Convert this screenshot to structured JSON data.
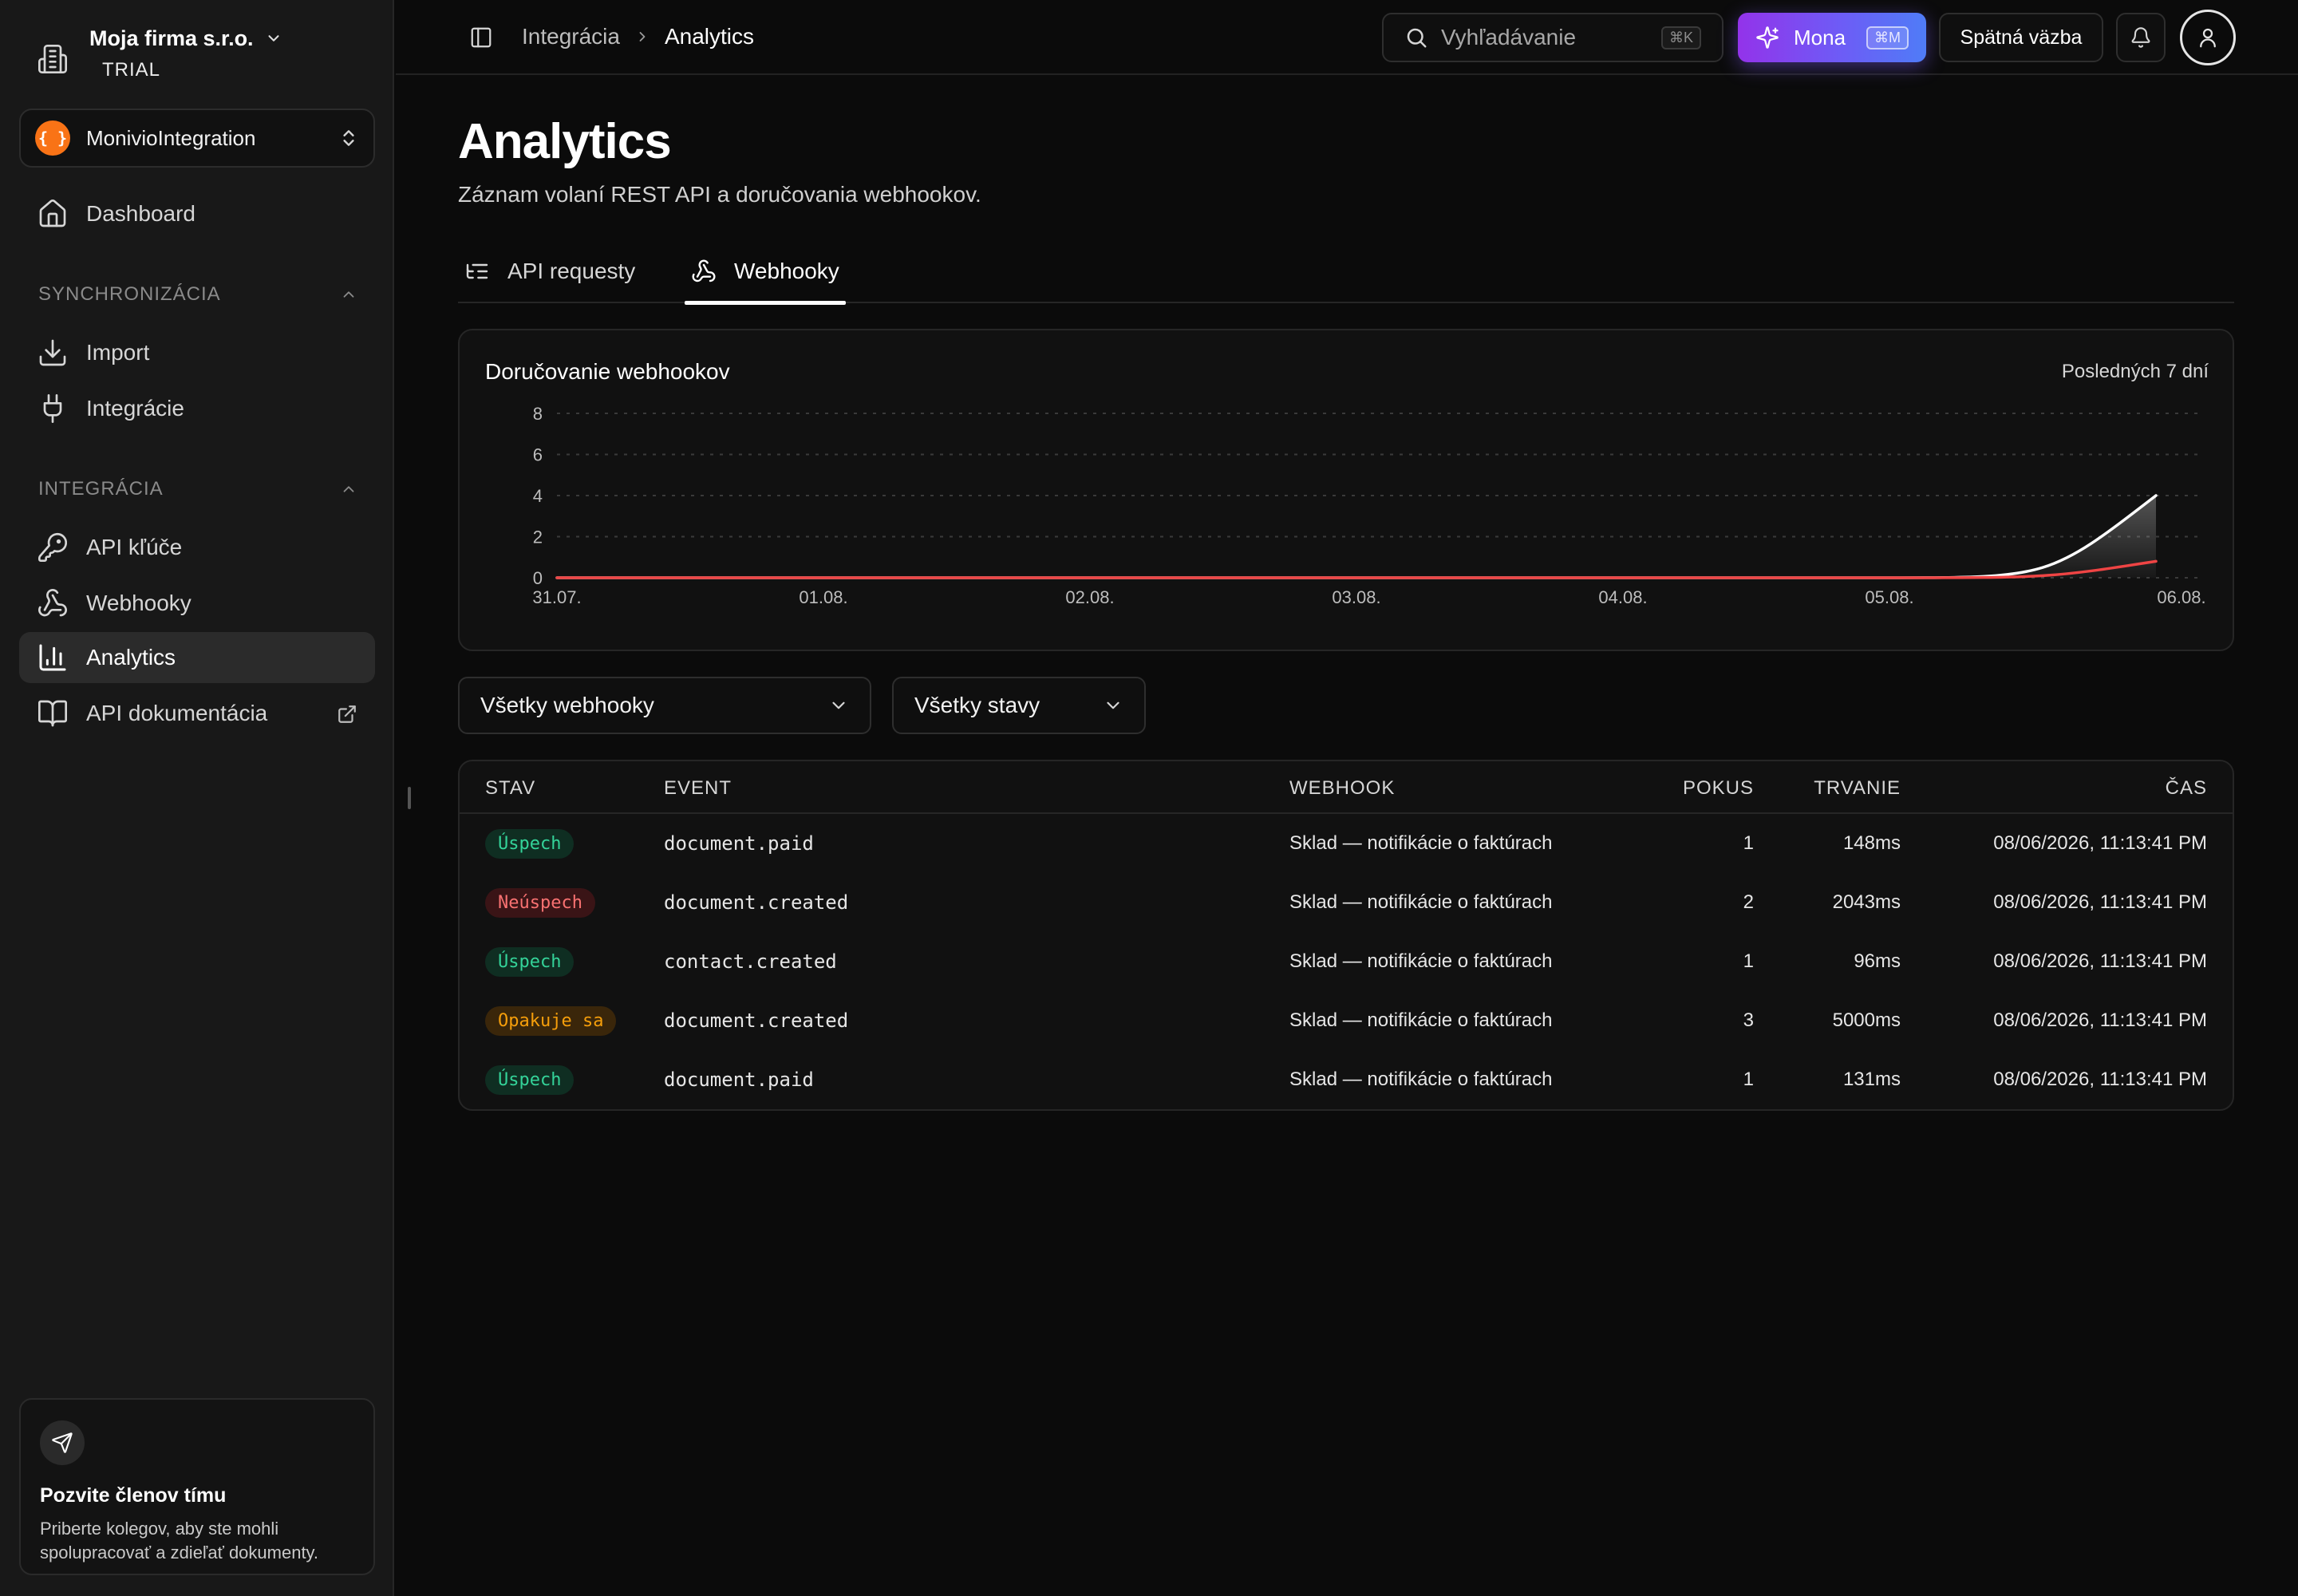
{
  "company": {
    "name": "Moja firma s.r.o.",
    "plan": "TRIAL"
  },
  "org": {
    "logo_text": "{ }",
    "name": "MonivioIntegration"
  },
  "sidebar": {
    "dashboard": "Dashboard",
    "section_sync": "SYNCHRONIZÁCIA",
    "import": "Import",
    "integracie": "Integrácie",
    "section_integration": "INTEGRÁCIA",
    "api_keys": "API kľúče",
    "webhooks": "Webhooky",
    "analytics": "Analytics",
    "api_docs": "API dokumentácia"
  },
  "invite": {
    "title": "Pozvite členov tímu",
    "desc": "Priberte kolegov, aby ste mohli spolupracovať a zdieľať dokumenty."
  },
  "breadcrumb": {
    "parent": "Integrácia",
    "current": "Analytics"
  },
  "search": {
    "placeholder": "Vyhľadávanie",
    "shortcut": "⌘K"
  },
  "mona": {
    "label": "Mona",
    "shortcut": "⌘M"
  },
  "feedback_label": "Spätná väzba",
  "page": {
    "title": "Analytics",
    "subtitle": "Záznam volaní REST API a doručovania webhookov."
  },
  "tabs": {
    "api": "API requesty",
    "webhooks": "Webhooky"
  },
  "chart_card": {
    "title": "Doručovanie webhookov",
    "range": "Posledných 7 dní"
  },
  "chart_data": {
    "type": "area",
    "title": "Doručovanie webhookov",
    "x": [
      "31.07.",
      "01.08.",
      "02.08.",
      "03.08.",
      "04.08.",
      "05.08.",
      "06.08."
    ],
    "y_ticks": [
      0,
      2,
      4,
      6,
      8
    ],
    "ylim": [
      0,
      8
    ],
    "grid": true,
    "x_end_label": "06.08.",
    "series": [
      {
        "color": "#ffffff",
        "values": [
          0,
          0,
          0,
          0,
          0,
          0,
          4
        ]
      },
      {
        "color": "#ef4444",
        "values": [
          0,
          0,
          0,
          0,
          0,
          0,
          0.8
        ]
      }
    ]
  },
  "filters": {
    "webhook": "Všetky webhooky",
    "status": "Všetky stavy"
  },
  "table": {
    "headers": {
      "stav": "STAV",
      "event": "EVENT",
      "webhook": "WEBHOOK",
      "pokus": "POKUS",
      "trvanie": "TRVANIE",
      "cas": "ČAS"
    },
    "rows": [
      {
        "status": "Úspech",
        "kind": "ok",
        "event": "document.paid",
        "webhook": "Sklad — notifikácie o faktúrach",
        "attempt": "1",
        "duration": "148ms",
        "time": "08/06/2026, 11:13:41 PM"
      },
      {
        "status": "Neúspech",
        "kind": "fail",
        "event": "document.created",
        "webhook": "Sklad — notifikácie o faktúrach",
        "attempt": "2",
        "duration": "2043ms",
        "time": "08/06/2026, 11:13:41 PM"
      },
      {
        "status": "Úspech",
        "kind": "ok",
        "event": "contact.created",
        "webhook": "Sklad — notifikácie o faktúrach",
        "attempt": "1",
        "duration": "96ms",
        "time": "08/06/2026, 11:13:41 PM"
      },
      {
        "status": "Opakuje sa",
        "kind": "retry",
        "event": "document.created",
        "webhook": "Sklad — notifikácie o faktúrach",
        "attempt": "3",
        "duration": "5000ms",
        "time": "08/06/2026, 11:13:41 PM"
      },
      {
        "status": "Úspech",
        "kind": "ok",
        "event": "document.paid",
        "webhook": "Sklad — notifikácie o faktúrach",
        "attempt": "1",
        "duration": "131ms",
        "time": "08/06/2026, 11:13:41 PM"
      }
    ]
  }
}
